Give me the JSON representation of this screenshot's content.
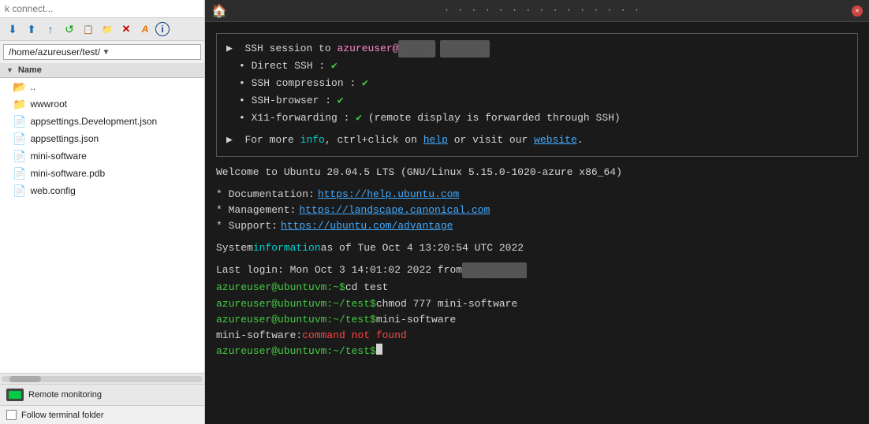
{
  "left": {
    "search_placeholder": "k connect...",
    "toolbar": {
      "buttons": [
        {
          "name": "download",
          "icon": "⬇",
          "class": "tb-blue"
        },
        {
          "name": "upload",
          "icon": "⬆",
          "class": "tb-up"
        },
        {
          "name": "up-folder",
          "icon": "⬆",
          "class": "tb-up"
        },
        {
          "name": "refresh",
          "icon": "↺",
          "class": "tb-green"
        },
        {
          "name": "copy",
          "icon": "📋",
          "class": "tb-yellow"
        },
        {
          "name": "new-folder",
          "icon": "📁",
          "class": "tb-blue2"
        },
        {
          "name": "delete",
          "icon": "✕",
          "class": "tb-red"
        },
        {
          "name": "rename",
          "icon": "A",
          "class": "tb-orange"
        },
        {
          "name": "info",
          "icon": "i",
          "class": "tb-darkblue"
        }
      ]
    },
    "path": "/home/azureuser/test/",
    "header_label": "Name",
    "files": [
      {
        "name": "..",
        "type": "folder_up"
      },
      {
        "name": "wwwroot",
        "type": "folder"
      },
      {
        "name": "appsettings.Development.json",
        "type": "file"
      },
      {
        "name": "appsettings.json",
        "type": "file"
      },
      {
        "name": "mini-software",
        "type": "file"
      },
      {
        "name": "mini-software.pdb",
        "type": "file"
      },
      {
        "name": "web.config",
        "type": "file"
      }
    ],
    "remote_monitoring_label": "Remote monitoring",
    "follow_folder_label": "Follow terminal folder"
  },
  "terminal": {
    "title": "· · · · · · · · · ·",
    "ssh_line": "▶  SSH session to ",
    "ssh_user": "azureuser@",
    "ssh_host_blur": "██ ████  ████",
    "direct_ssh": "Direct SSH",
    "ssh_compression": "SSH compression",
    "ssh_browser": "SSH-browser",
    "x11_forwarding": "X11-forwarding",
    "x11_note": "(remote display is forwarded through SSH)",
    "check": "✔",
    "info_line": "▶  For more ",
    "info_cyan": "info",
    "info_mid": ", ctrl+click on ",
    "info_link_help": "help",
    "info_mid2": " or visit our ",
    "info_link_website": "website",
    "info_end": ".",
    "welcome": "Welcome to Ubuntu 20.04.5 LTS (GNU/Linux 5.15.0-1020-azure x86_64)",
    "doc_label": "* Documentation:",
    "doc_url": "https://help.ubuntu.com",
    "mgmt_label": "* Management:   ",
    "mgmt_url": "https://landscape.canonical.com",
    "support_label": "* Support:      ",
    "support_url": "https://ubuntu.com/advantage",
    "sysinfo": "  System ",
    "sysinfo_cyan": "information",
    "sysinfo_end": " as of Tue Oct  4 13:20:54 UTC 2022",
    "last_login": "Last login: Mon Oct  3 14:01:02 2022 from ",
    "last_login_blur": "███ ██ ███",
    "cmd1_prompt": "azureuser@ubuntuvm:~$ ",
    "cmd1": "cd test",
    "cmd2_prompt": "azureuser@ubuntuvm:~/test$ ",
    "cmd2": "chmod 777 mini-software",
    "cmd3_prompt": "azureuser@ubuntuvm:~/test$ ",
    "cmd3": "mini-software",
    "err_prog": "mini-software: ",
    "err_msg": "command not found",
    "cmd4_prompt": "azureuser@ubuntuvm:~/test$ "
  }
}
